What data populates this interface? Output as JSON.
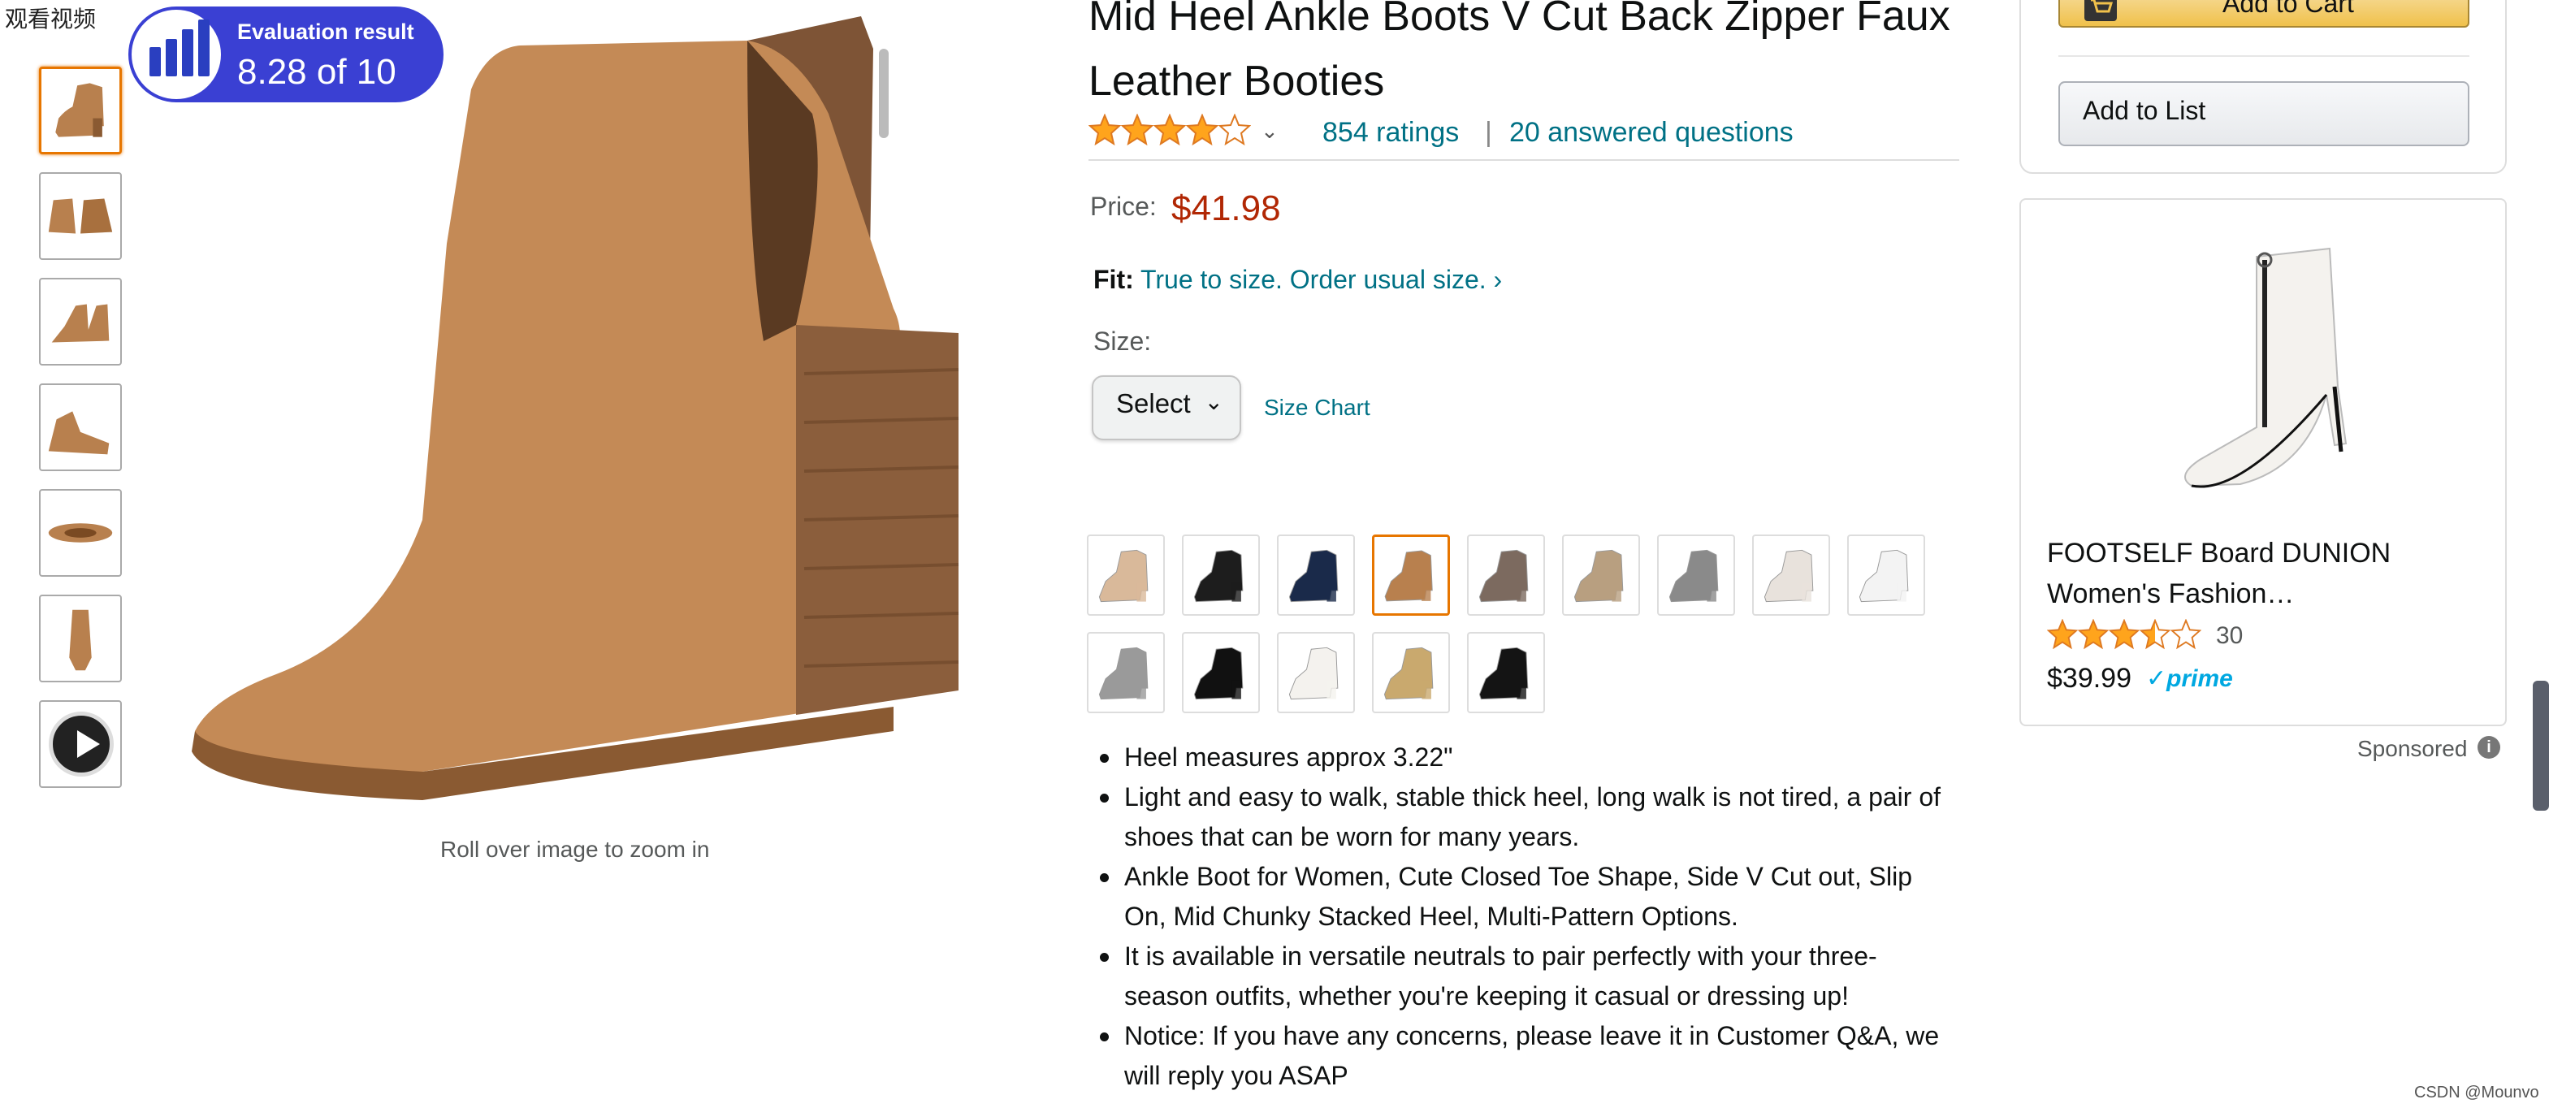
{
  "overlay": {
    "text": "观看视频"
  },
  "evaluation": {
    "label": "Evaluation result",
    "score": "8.28 of 10"
  },
  "gallery": {
    "thumbnails": [
      "thumb-1",
      "thumb-2",
      "thumb-3",
      "thumb-4",
      "thumb-5",
      "thumb-6",
      "video"
    ],
    "zoom_hint": "Roll over image to zoom in"
  },
  "product": {
    "title": "Mid Heel Ankle Boots V Cut Back Zipper Faux Leather Booties",
    "rating": 4.0,
    "ratings_count": "854 ratings",
    "separator": "|",
    "answered_questions": "20 answered questions",
    "price_label": "Price:",
    "price": "$41.98",
    "fit_label": "Fit:",
    "fit_text": "True to size. Order usual size.",
    "fit_chevron": "›",
    "size_label": "Size:",
    "size_select": "Select",
    "size_chart": "Size Chart",
    "swatch_colors": [
      "#d9b99a",
      "#1d1d1d",
      "#1a2a4a",
      "#b8804e",
      "#7c6a5f",
      "#b89f80",
      "#8a8a8a",
      "#e8e2dc",
      "#f3f3f3",
      "#9a9a9a",
      "#111111",
      "#f4f2ee",
      "#c9a96e",
      "#141414"
    ],
    "selected_swatch": 3,
    "bullets": [
      "Heel measures approx 3.22\"",
      "Light and easy to walk, stable thick heel, long walk is not tired, a pair of shoes that can be worn for many years.",
      "Ankle Boot for Women, Cute Closed Toe Shape, Side V Cut out, Slip On, Mid Chunky Stacked Heel, Multi-Pattern Options.",
      "It is available in versatile neutrals to pair perfectly with your three-season outfits, whether you're keeping it casual or dressing up!",
      "Notice: If you have any concerns, please leave it in Customer Q&A, we will reply you ASAP"
    ]
  },
  "buybox": {
    "add_to_cart": "Add to Cart",
    "add_to_list": "Add to List"
  },
  "ad": {
    "title": "FOOTSELF Board DUNION Women's Fashion…",
    "rating": 3.5,
    "count": "30",
    "price": "$39.99",
    "prime": "✓prime",
    "sponsored": "Sponsored",
    "info": "i"
  },
  "watermark": "CSDN @Mounvo",
  "colors": {
    "accent_orange": "#e77600",
    "link": "#007185",
    "price": "#B12704",
    "badge": "#3a40d3",
    "star": "#FFA41C"
  }
}
